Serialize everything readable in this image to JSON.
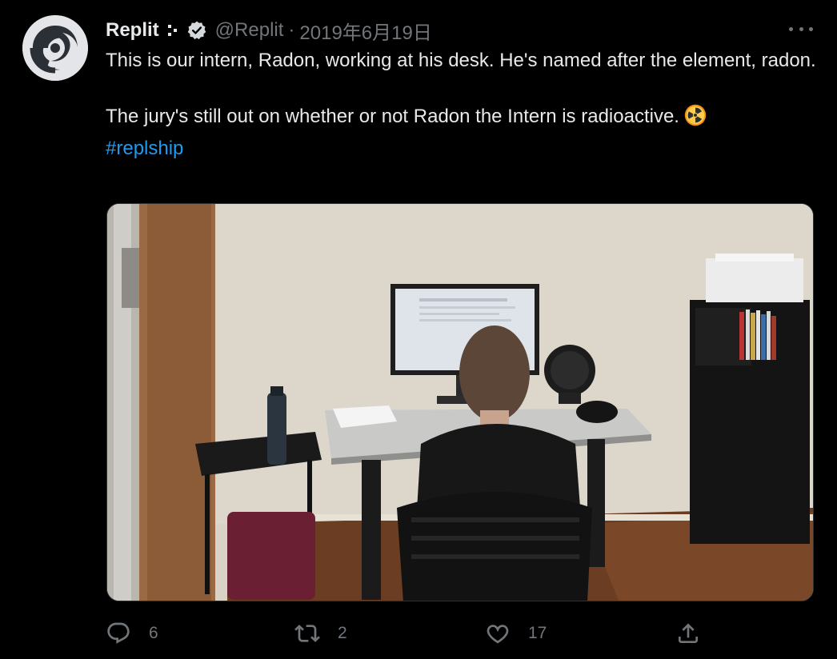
{
  "author": {
    "display_name": "Replit",
    "handle": "@Replit",
    "separator": "·",
    "timestamp": "2019年6月19日",
    "avatar_icon": "replit-logo-icon",
    "verified_icon": "verified-badge-icon",
    "affiliate_icon": "replit-affiliate-icon"
  },
  "tweet": {
    "line1": "This is our intern, Radon, working at his desk. He's named after the element, radon.",
    "line2": "The jury's still out on whether or not Radon the Intern is radioactive.",
    "emoji": "radioactive-emoji-icon",
    "hashtag": "#replship"
  },
  "media": {
    "description_icon": "photo"
  },
  "actions": {
    "reply_count": "6",
    "retweet_count": "2",
    "like_count": "17"
  },
  "colors": {
    "background": "#000000",
    "text": "#e7e9ea",
    "muted": "#71767b",
    "link": "#1d9bf0"
  }
}
